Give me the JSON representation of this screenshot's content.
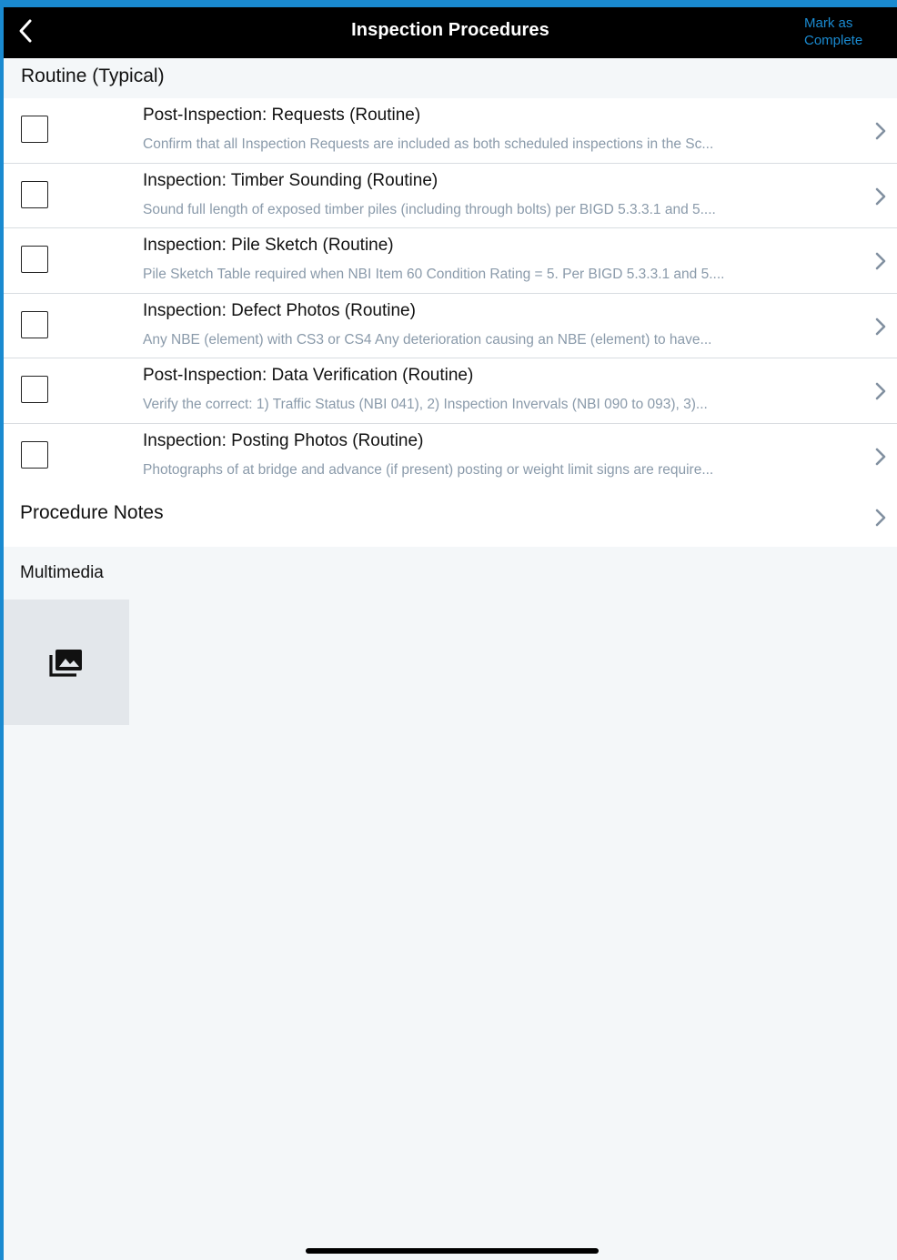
{
  "navbar": {
    "title": "Inspection Procedures",
    "back_icon": "chevron-left-icon",
    "mark_complete_line1": "Mark as",
    "mark_complete_line2": "Complete"
  },
  "section": {
    "title": "Routine (Typical)"
  },
  "procedures": [
    {
      "title": "Post-Inspection: Requests (Routine)",
      "subtitle": "Confirm that all Inspection Requests are included as both scheduled inspections in the Sc...",
      "checked": false
    },
    {
      "title": "Inspection: Timber Sounding (Routine)",
      "subtitle": "Sound full length of exposed timber piles (including through bolts) per BIGD 5.3.3.1 and 5....",
      "checked": false
    },
    {
      "title": "Inspection: Pile Sketch (Routine)",
      "subtitle": "Pile Sketch Table required when NBI Item 60 Condition Rating = 5. Per BIGD 5.3.3.1 and 5....",
      "checked": false
    },
    {
      "title": "Inspection: Defect Photos (Routine)",
      "subtitle": "Any NBE (element) with CS3 or CS4 Any deterioration causing an NBE (element) to have...",
      "checked": false
    },
    {
      "title": "Post-Inspection: Data Verification (Routine)",
      "subtitle": "Verify the correct: 1) Traffic Status (NBI 041), 2) Inspection Invervals (NBI 090 to 093), 3)...",
      "checked": false
    },
    {
      "title": "Inspection: Posting Photos (Routine)",
      "subtitle": "Photographs of at bridge and advance (if present) posting or weight limit signs are require...",
      "checked": false
    }
  ],
  "notes": {
    "label": "Procedure Notes"
  },
  "multimedia": {
    "label": "Multimedia",
    "tile_icon": "photo-library-icon"
  },
  "colors": {
    "accent": "#1a8ad0",
    "navbar_bg": "#000000",
    "subtitle_text": "#8a9aaa",
    "chevron": "#8190a0"
  }
}
